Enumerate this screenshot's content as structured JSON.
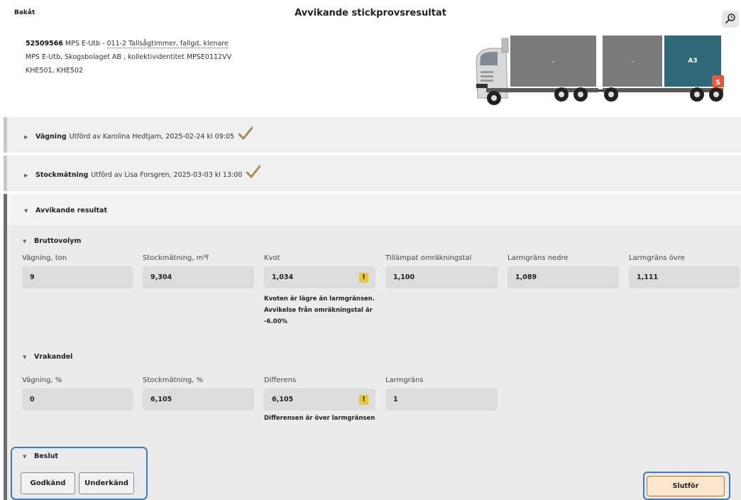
{
  "header": {
    "back_label": "Bakåt",
    "title": "Avvikande stickprovsresultat",
    "search_icon": "magnifier-clock-icon"
  },
  "info": {
    "id": "52509566",
    "line1_prefix": " MPS E-Utb - ",
    "line1_assortment": "011-2 Tallsågtimmer, fallgd, klenare",
    "line2": "MPS E-Utb, Skogsbolaget AB , kollektividentitet MPSE0112VV",
    "line3": "KHE501, KHE502"
  },
  "truck": {
    "compartments": [
      {
        "label": "-",
        "color": "#7a7a7a"
      },
      {
        "label": "-",
        "color": "#7a7a7a"
      },
      {
        "label": "A3",
        "color": "#2f6877"
      }
    ],
    "badge": "S",
    "badge_color": "#e3593f"
  },
  "vagning_row": {
    "title": "Vägning",
    "text": "Utförd av Karolina Hedtjarn, 2025-02-24 kl 09:05"
  },
  "stock_row": {
    "title": "Stockmätning",
    "text": "Utförd av Lisa Forsgren, 2025-03-03 kl 13:00"
  },
  "avvikande": {
    "title": "Avvikande resultat",
    "bruttovolym": {
      "title": "Bruttovolym",
      "fields": [
        {
          "label": "Vägning, ton",
          "value": "9"
        },
        {
          "label": "Stockmätning, m³f",
          "value": "9,304"
        },
        {
          "label": "Kvot",
          "value": "1,034"
        },
        {
          "label": "Tillämpat omräkningstal",
          "value": "1,100"
        },
        {
          "label": "Larmgräns nedre",
          "value": "1,089"
        },
        {
          "label": "Larmgräns övre",
          "value": "1,111"
        }
      ],
      "warning_symbol": "!",
      "note_lines": [
        "Kvoten är lägre än larmgränsen.",
        "Avvikelse från omräkningstal är",
        "-6.00%"
      ]
    },
    "vrakandel": {
      "title": "Vrakandel",
      "fields": [
        {
          "label": "Vägning, %",
          "value": "0"
        },
        {
          "label": "Stockmätning, %",
          "value": "6,105"
        },
        {
          "label": "Differens",
          "value": "6,105"
        },
        {
          "label": "Larmgräns",
          "value": "1"
        }
      ],
      "warning_symbol": "!",
      "note": "Differensen är över larmgränsen"
    }
  },
  "beslut": {
    "title": "Beslut",
    "approve_label": "Godkänd",
    "reject_label": "Underkänd"
  },
  "finish_label": "Slutför",
  "colors": {
    "check": "#a08d55",
    "warning": "#e7c83f",
    "focus_outline": "#3e7bc0",
    "finish_button": "#fbe5cc"
  }
}
